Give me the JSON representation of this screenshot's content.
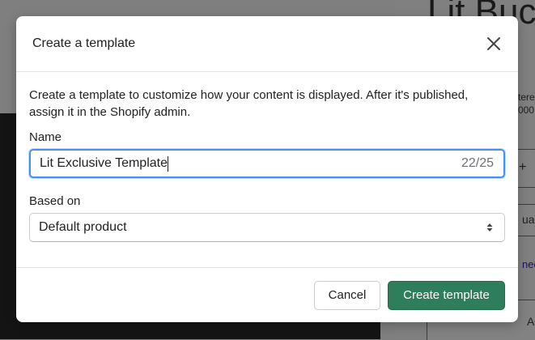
{
  "background": {
    "product_title": "Lit Buck",
    "partial_texts": [
      "tere",
      "000"
    ],
    "plus_sign": "+",
    "partial_label": "ua",
    "partial_link": "ned",
    "partial_bottom": "A"
  },
  "modal": {
    "title": "Create a template",
    "description": "Create a template to customize how your content is displayed. After it's published, assign it in the Shopify admin.",
    "name_field": {
      "label": "Name",
      "value": "Lit Exclusive Template",
      "char_count": "22/25"
    },
    "based_on_field": {
      "label": "Based on",
      "selected": "Default product"
    },
    "cancel_label": "Cancel",
    "create_label": "Create template",
    "colors": {
      "primary": "#2e7d5b",
      "focus_border": "#458fff"
    },
    "icons": {
      "close": "close-icon",
      "select": "select-arrows-icon"
    }
  }
}
